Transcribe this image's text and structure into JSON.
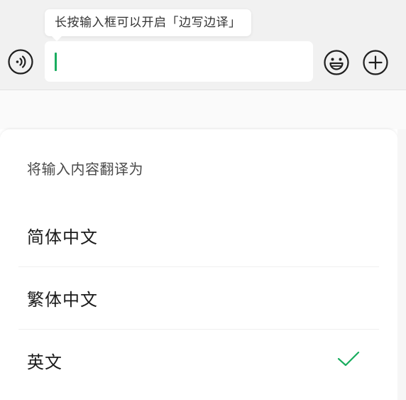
{
  "input_bar": {
    "tooltip": "长按输入框可以开启「边写边译」",
    "text_value": "",
    "voice_icon": "voice-input-icon",
    "emoji_icon": "emoji-icon",
    "plus_icon": "plus-circle-icon"
  },
  "sheet": {
    "title": "将输入内容翻译为",
    "options": [
      {
        "label": "简体中文",
        "selected": false
      },
      {
        "label": "繁体中文",
        "selected": false
      },
      {
        "label": "英文",
        "selected": true
      }
    ],
    "check_icon": "checkmark-icon"
  },
  "colors": {
    "accent": "#1aad5f",
    "bar_background": "#f1f1f1",
    "sheet_background": "#ffffff"
  }
}
